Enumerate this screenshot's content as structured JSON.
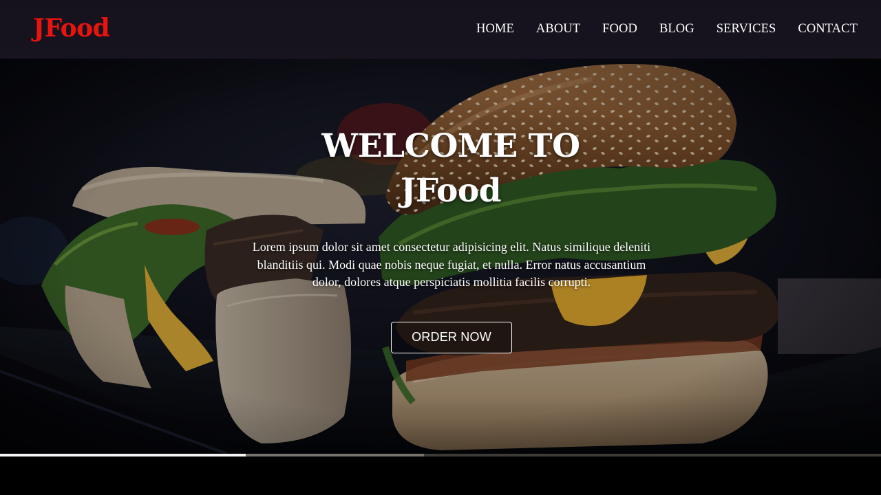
{
  "brand": {
    "name": "JFood",
    "color": "#e8140f"
  },
  "nav": {
    "items": [
      {
        "label": "HOME"
      },
      {
        "label": "ABOUT"
      },
      {
        "label": "FOOD"
      },
      {
        "label": "BLOG"
      },
      {
        "label": "SERVICES"
      },
      {
        "label": "CONTACT"
      }
    ]
  },
  "hero": {
    "title_line1": "WELCOME TO",
    "title_line2": "JFood",
    "text": "Lorem ipsum dolor sit amet consectetur adipisicing elit. Natus similique deleniti blanditiis qui. Modi quae nobis neque fugiat, et nulla. Error natus accusantium dolor, dolores atque perspiciatis mollitia facilis corrupti.",
    "button_label": "ORDER NOW",
    "background_image": "burger-photo"
  },
  "video": {
    "progress_played_fraction": 0.279,
    "progress_buffered_fraction": 0.481
  }
}
